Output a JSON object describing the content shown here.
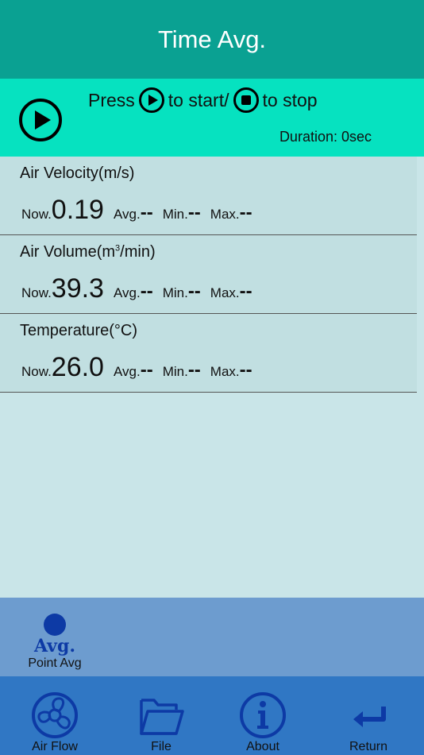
{
  "header": {
    "title": "Time Avg."
  },
  "control": {
    "press": "Press",
    "to_start": "to start/",
    "to_stop": "to stop",
    "duration": "Duration: 0sec"
  },
  "rows": [
    {
      "label": "Air Velocity(m/s)",
      "now_label": "Now.",
      "now": "0.19",
      "avg_label": "Avg.",
      "avg": "--",
      "min_label": "Min.",
      "min": "--",
      "max_label": "Max.",
      "max": "--"
    },
    {
      "label_pre": "Air Volume(m",
      "label_sup": "3",
      "label_post": "/min)",
      "now_label": "Now.",
      "now": "39.3",
      "avg_label": "Avg.",
      "avg": "--",
      "min_label": "Min.",
      "min": "--",
      "max_label": "Max.",
      "max": "--"
    },
    {
      "label": "Temperature(°C)",
      "now_label": "Now.",
      "now": "26.0",
      "avg_label": "Avg.",
      "avg": "--",
      "min_label": "Min.",
      "min": "--",
      "max_label": "Max.",
      "max": "--"
    }
  ],
  "mode": {
    "icon_text": "Avg.",
    "label": "Point Avg"
  },
  "tabs": [
    {
      "label": "Air Flow",
      "icon": "fan-icon"
    },
    {
      "label": "File",
      "icon": "folder-icon"
    },
    {
      "label": "About",
      "icon": "info-icon"
    },
    {
      "label": "Return",
      "icon": "return-arrow-icon"
    }
  ],
  "colors": {
    "header": "#0aa192",
    "control": "#06e2c0",
    "background": "#c9e5e8",
    "mode_bar": "#6d9ccf",
    "tab_bar": "#3077c4",
    "icon": "#0d3aa5"
  }
}
